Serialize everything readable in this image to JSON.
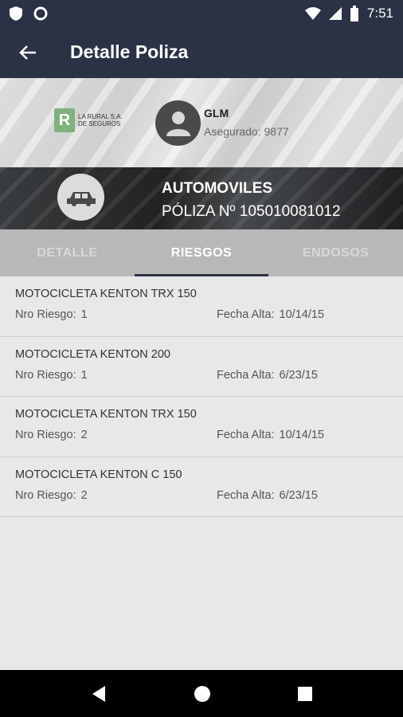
{
  "status_bar": {
    "time": "7:51"
  },
  "app_bar": {
    "title": "Detalle Poliza",
    "back_icon": "arrow-left-icon"
  },
  "header": {
    "company_logo_letter": "R",
    "company_logo_text": "LA RURAL S.A. DE SEGUROS",
    "user_name": "GLM",
    "insured_label": "Asegurado:",
    "insured_number": "9877",
    "policy_type": "AUTOMOVILES",
    "policy_number_label": "PÓLIZA Nº",
    "policy_number": "105010081012"
  },
  "tabs": [
    {
      "label": "DETALLE",
      "active": false
    },
    {
      "label": "RIESGOS",
      "active": true
    },
    {
      "label": "ENDOSOS",
      "active": false
    }
  ],
  "risk_labels": {
    "nro": "Nro Riesgo:",
    "fecha": "Fecha Alta:"
  },
  "risks": [
    {
      "title": "MOTOCICLETA KENTON TRX 150",
      "nro": "1",
      "fecha": "10/14/15"
    },
    {
      "title": "MOTOCICLETA KENTON 200",
      "nro": "1",
      "fecha": "6/23/15"
    },
    {
      "title": "MOTOCICLETA KENTON TRX 150",
      "nro": "2",
      "fecha": "10/14/15"
    },
    {
      "title": "MOTOCICLETA KENTON C 150",
      "nro": "2",
      "fecha": "6/23/15"
    }
  ],
  "colors": {
    "primary": "#2b3245",
    "tab_bar": "#b8b8b8",
    "background": "#e8e8e8"
  }
}
